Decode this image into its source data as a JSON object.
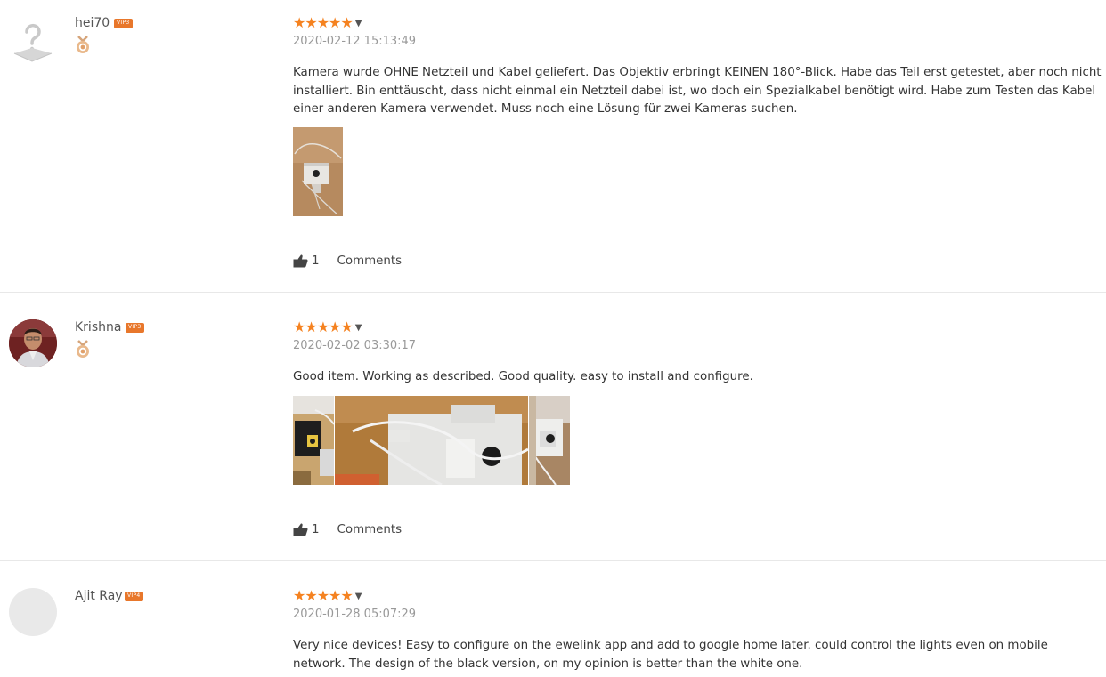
{
  "reviews": [
    {
      "username": "hei70",
      "vip": "VIP3",
      "rating": 5,
      "date": "2020-02-12 15:13:49",
      "text": "Kamera wurde OHNE Netzteil und Kabel geliefert. Das Objektiv erbringt KEINEN 180°-Blick. Habe das Teil erst getestet, aber noch nicht installiert. Bin enttäuscht, dass nicht einmal ein Netzteil dabei ist, wo doch ein Spezialkabel benötigt wird. Habe zum Testen das Kabel einer anderen Kamera verwendet. Muss noch eine Lösung für zwei Kameras suchen.",
      "likes": "1",
      "comments_label": "Comments"
    },
    {
      "username": "Krishna",
      "vip": "VIP3",
      "rating": 5,
      "date": "2020-02-02 03:30:17",
      "text": "Good item. Working as described. Good quality. easy to install and configure.",
      "likes": "1",
      "comments_label": "Comments"
    },
    {
      "username": "Ajit Ray",
      "vip": "VIP4",
      "rating": 5,
      "date": "2020-01-28 05:07:29",
      "text": "Very nice devices! Easy to configure on the ewelink app and add to google home later. could control the lights even on mobile network. The design of the black version, on my opinion is better than the white one."
    }
  ],
  "colors": {
    "star": "#f58220",
    "vip_badge": "#e8772b",
    "separator": "#e8e8e8"
  }
}
